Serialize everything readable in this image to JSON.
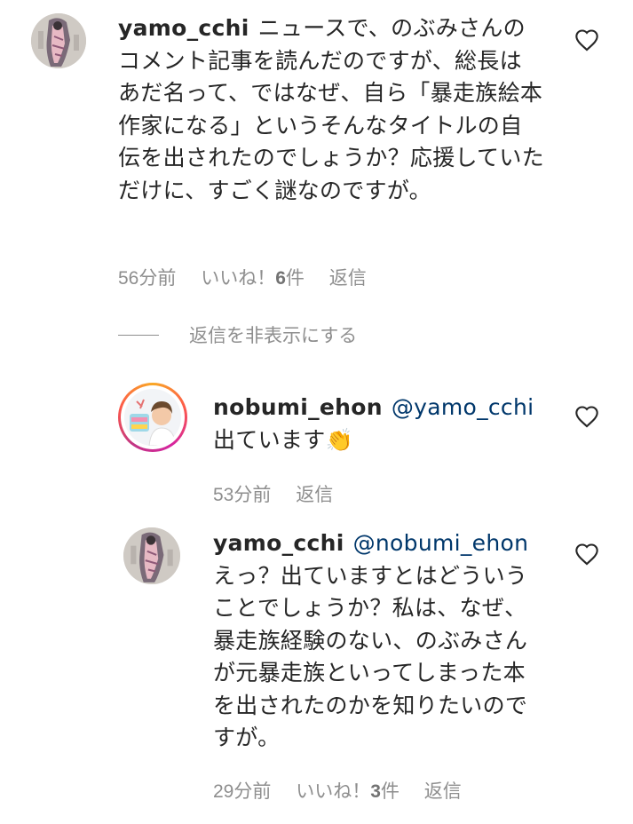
{
  "comments": [
    {
      "username": "yamo_cchi",
      "mention": "",
      "text": "ニュースで、のぶみさんのコメント記事を読んだのですが、総長はあだ名って、ではなぜ、自ら「暴走族絵本作家になる」というそんなタイトルの自伝を出されたのでしょうか？応援していただけに、すごく謎なのですが。",
      "time": "56分前",
      "likes_prefix": "いいね！",
      "likes_count": "6",
      "likes_suffix": "件",
      "reply": "返信"
    },
    {
      "username": "nobumi_ehon",
      "mention": "@yamo_cchi",
      "text": "出ています👏",
      "time": "53分前",
      "reply": "返信"
    },
    {
      "username": "yamo_cchi",
      "mention": "@nobumi_ehon",
      "text": "えっ？出ていますとはどういうことでしょうか？私は、なぜ、暴走族経験のない、のぶみさんが元暴走族といってしまった本を出されたのかを知りたいのですが。",
      "time": "29分前",
      "likes_prefix": "いいね！",
      "likes_count": "3",
      "likes_suffix": "件",
      "reply": "返信"
    }
  ],
  "hide_replies_label": "返信を非表示にする",
  "colors": {
    "text": "#262626",
    "meta": "#8e8e8e",
    "mention": "#00376b",
    "story_ring_start": "#f9a825",
    "story_ring_end": "#c13584"
  },
  "icons": {
    "like": "heart-outline-icon",
    "clap": "clapping-hands-emoji"
  }
}
